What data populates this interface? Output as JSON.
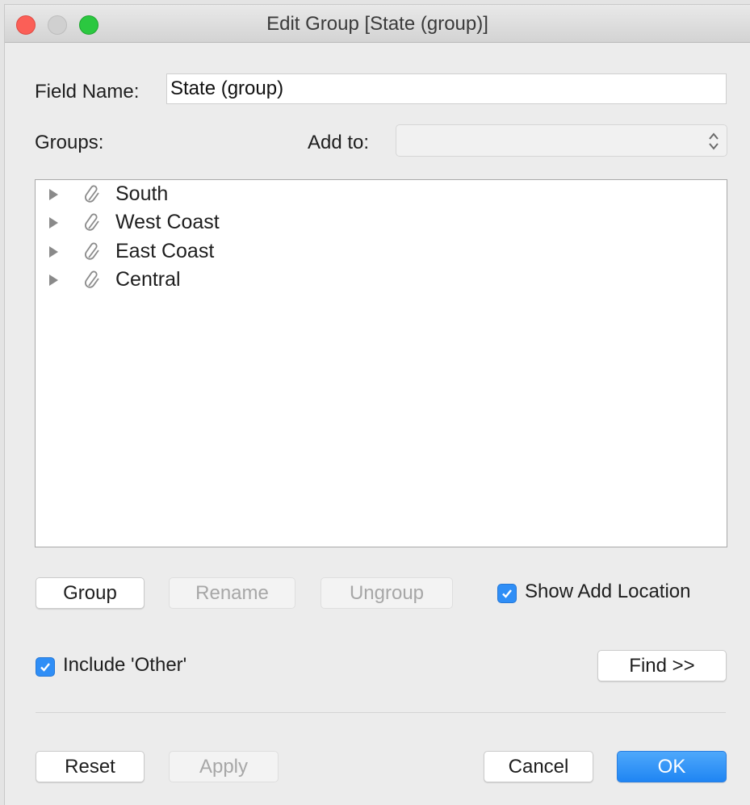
{
  "window": {
    "title": "Edit Group [State (group)]"
  },
  "field_name": {
    "label": "Field Name:",
    "value": "State (group)"
  },
  "groups": {
    "label": "Groups:",
    "add_to_label": "Add to:",
    "add_to_value": "",
    "items": [
      {
        "label": "South",
        "icon": "paperclip-icon",
        "expander": "disclosure-triangle-right-icon"
      },
      {
        "label": "West Coast",
        "icon": "paperclip-icon",
        "expander": "disclosure-triangle-right-icon"
      },
      {
        "label": "East Coast",
        "icon": "paperclip-icon",
        "expander": "disclosure-triangle-right-icon"
      },
      {
        "label": "Central",
        "icon": "paperclip-icon",
        "expander": "disclosure-triangle-right-icon"
      }
    ]
  },
  "actions": {
    "group_label": "Group",
    "rename_label": "Rename",
    "ungroup_label": "Ungroup",
    "show_add_location_label": "Show Add Location",
    "show_add_location_checked": true
  },
  "options": {
    "include_other_label": "Include 'Other'",
    "include_other_checked": true,
    "find_label": "Find >>"
  },
  "footer": {
    "reset_label": "Reset",
    "apply_label": "Apply",
    "cancel_label": "Cancel",
    "ok_label": "OK"
  },
  "colors": {
    "accent": "#1f85f3",
    "close": "#fb5f57",
    "zoom": "#2bc840"
  }
}
